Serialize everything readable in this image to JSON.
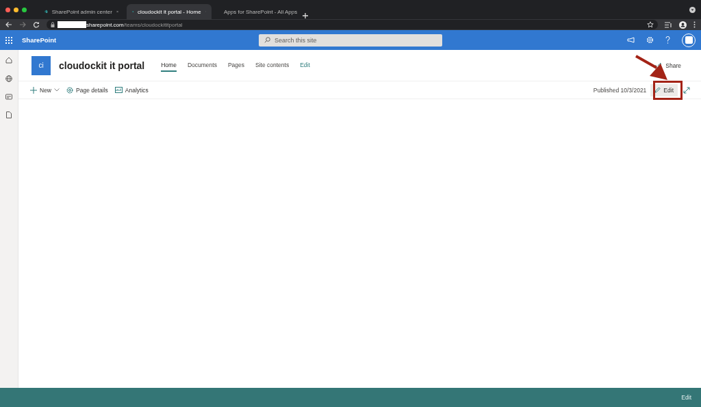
{
  "browser": {
    "tabs": [
      {
        "title": "SharePoint admin center",
        "selected": false
      },
      {
        "title": "cloudockit it portal - Home",
        "selected": true
      },
      {
        "title": "Apps for SharePoint - All Apps",
        "selected": false
      }
    ],
    "url": {
      "host": "sharepoint.com",
      "path": "/teams/cloudockititportal"
    }
  },
  "suite_bar": {
    "app_name": "SharePoint",
    "search": {
      "placeholder": "Search this site"
    }
  },
  "site": {
    "logo": "ci",
    "title": "cloudockit it portal",
    "nav": [
      {
        "label": "Home",
        "selected": true
      },
      {
        "label": "Documents",
        "selected": false
      },
      {
        "label": "Pages",
        "selected": false
      },
      {
        "label": "Site contents",
        "selected": false
      }
    ],
    "nav_edit": "Edit",
    "share": "Share"
  },
  "command_bar": {
    "items": [
      {
        "kind": "new",
        "label": "New"
      },
      {
        "kind": "details",
        "label": "Page details"
      },
      {
        "kind": "analytics",
        "label": "Analytics"
      }
    ],
    "published": "Published 10/3/2021",
    "edit": "Edit"
  },
  "footer": {
    "edit": "Edit"
  }
}
